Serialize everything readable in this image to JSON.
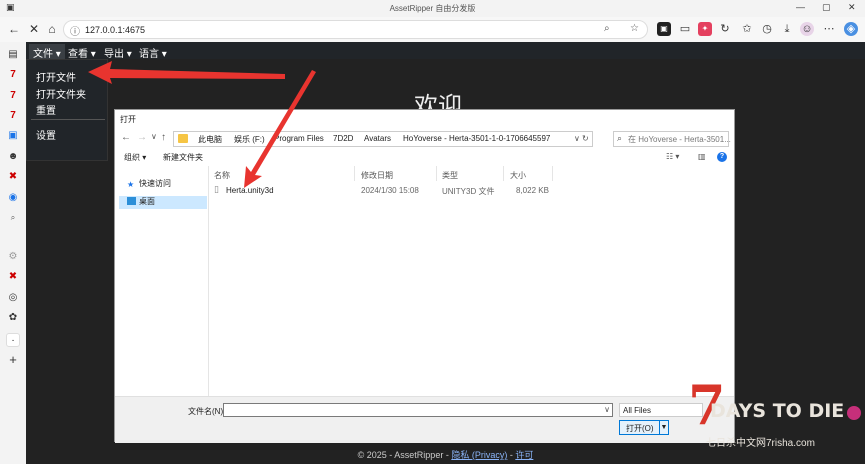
{
  "browser": {
    "title": "AssetRipper 自由分发版",
    "url": "127.0.0.1:4675"
  },
  "menu": {
    "items": [
      "文件 ▾",
      "查看 ▾",
      "导出 ▾",
      "语言 ▾"
    ],
    "file_dropdown": [
      "打开文件",
      "打开文件夹",
      "重置",
      "设置"
    ]
  },
  "welcome": "欢迎",
  "footer": {
    "prefix": "© 2025 - AssetRipper - ",
    "privacy": "隐私 (Privacy)",
    "sep": " - ",
    "license": "许可"
  },
  "dialog": {
    "title": "打开",
    "breadcrumb": [
      "此电脑",
      "娱乐 (F:)",
      "Program Files",
      "7D2D",
      "Avatars",
      "HoYoverse - Herta-3501-1-0-1706645597"
    ],
    "search_placeholder": "在 HoYoverse - Herta-3501...",
    "toolbar": {
      "organize": "组织 ▾",
      "new_folder": "新建文件夹"
    },
    "tree": [
      "快速访问",
      "桌面"
    ],
    "columns": [
      "名称",
      "修改日期",
      "类型",
      "大小"
    ],
    "files": [
      {
        "name": "Herta.unity3d",
        "date": "2024/1/30 15:08",
        "type": "UNITY3D 文件",
        "size": "8,022 KB"
      }
    ],
    "filename_label": "文件名(N):",
    "filename_value": "",
    "filetype": "All Files",
    "open_button": "打开(O)"
  },
  "watermark": {
    "logo": "7",
    "game": "DAYS TO DIE",
    "site": "七日杀中文网7risha.com"
  },
  "colors": {
    "app_bg": "#222222",
    "arrow": "#e8342f",
    "selection": "#cce8ff"
  }
}
